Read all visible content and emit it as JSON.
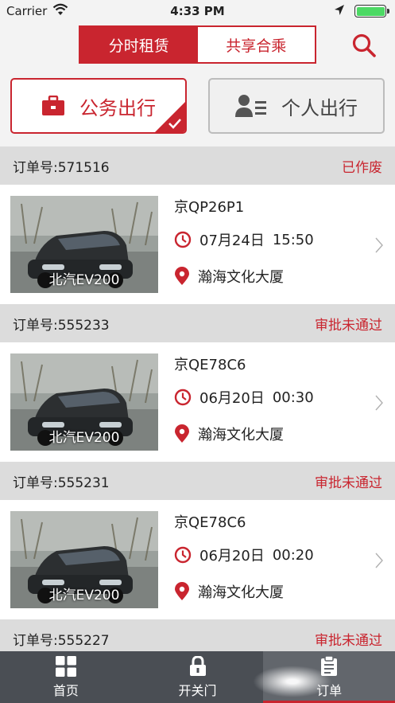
{
  "status_bar": {
    "carrier": "Carrier",
    "time": "4:33 PM"
  },
  "nav": {
    "tab_rental": "分时租赁",
    "tab_carpool": "共享合乘",
    "search_icon": "search-icon"
  },
  "trip_type": {
    "business": "公务出行",
    "personal": "个人出行"
  },
  "orders": [
    {
      "order_no": "订单号:571516",
      "status": "已作废",
      "plate": "京QP26P1",
      "model": "北汽EV200",
      "date": "07月24日",
      "time": "15:50",
      "location": "瀚海文化大厦"
    },
    {
      "order_no": "订单号:555233",
      "status": "审批未通过",
      "plate": "京QE78C6",
      "model": "北汽EV200",
      "date": "06月20日",
      "time": "00:30",
      "location": "瀚海文化大厦"
    },
    {
      "order_no": "订单号:555231",
      "status": "审批未通过",
      "plate": "京QE78C6",
      "model": "北汽EV200",
      "date": "06月20日",
      "time": "00:20",
      "location": "瀚海文化大厦"
    },
    {
      "order_no": "订单号:555227",
      "status": "审批未通过"
    }
  ],
  "tabs": [
    {
      "label": "首页",
      "icon": "grid-icon"
    },
    {
      "label": "开关门",
      "icon": "lock-icon"
    },
    {
      "label": "订单",
      "icon": "clipboard-icon"
    }
  ],
  "colors": {
    "accent": "#c9252f",
    "tab_bar": "#4a4e54"
  }
}
